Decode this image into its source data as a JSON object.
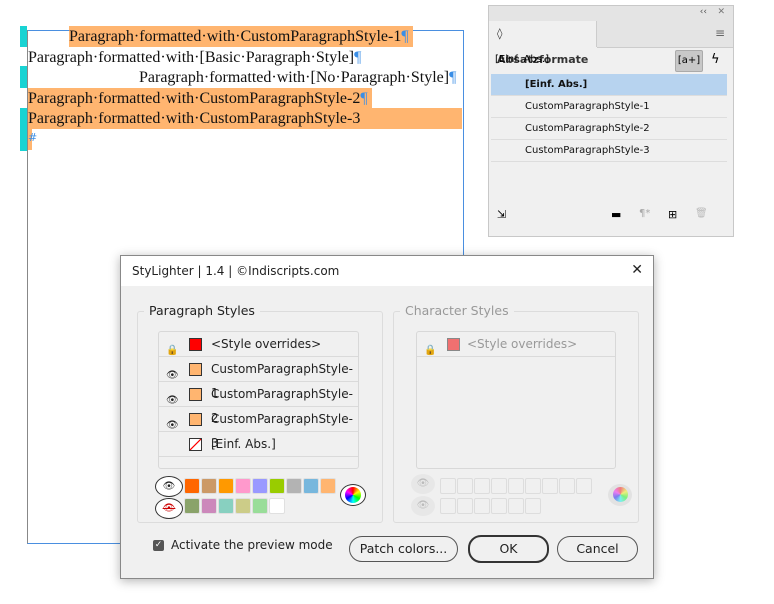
{
  "document": {
    "lines": [
      "Paragraph·formatted·with·CustomParagraphStyle-1",
      "Paragraph·formatted·with·[Basic·Paragraph·Style]",
      "Paragraph·formatted·with·[No·Paragraph·Style]",
      "Paragraph·formatted·with·CustomParagraphStyle-2",
      "Paragraph·formatted·with·CustomParagraphStyle-3"
    ],
    "pilcrow": "¶",
    "end_mark": "#",
    "highlight_color": "#ffb570"
  },
  "panel": {
    "collapse": "‹‹",
    "close": "✕",
    "title": "Absatzformate",
    "current_style": "[Einf. Abs.]",
    "new_style_btn": "[a+]",
    "styles": [
      "[Einf. Abs.]",
      "CustomParagraphStyle-1",
      "CustomParagraphStyle-2",
      "CustomParagraphStyle-3"
    ],
    "selected_index": 0
  },
  "dialog": {
    "title": "StyLighter | 1.4 | ©Indiscripts.com",
    "close": "✕",
    "paragraph_group": "Paragraph Styles",
    "character_group": "Character Styles",
    "paragraph_styles": [
      {
        "label": "<Style overrides>",
        "icon": "lock-icon",
        "color": "#ff0000"
      },
      {
        "label": "CustomParagraphStyle-1",
        "icon": "eye-icon",
        "color": "#ffb570"
      },
      {
        "label": "CustomParagraphStyle-2",
        "icon": "eye-icon",
        "color": "#ffb570"
      },
      {
        "label": "CustomParagraphStyle-3",
        "icon": "eye-icon",
        "color": "#ffb570"
      },
      {
        "label": "[Einf. Abs.]",
        "icon": "none",
        "color": "none"
      }
    ],
    "character_styles": [
      {
        "label": "<Style overrides>",
        "icon": "lock-icon",
        "color": "#f07070"
      }
    ],
    "palette_row1": [
      "#ff6600",
      "#cc9966",
      "#ff9900",
      "#ff99cc",
      "#9999ff",
      "#99cc00",
      "#b3b3b3",
      "#77b7dd",
      "#ffb570"
    ],
    "palette_row2": [
      "#8aa36a",
      "#cc88bb",
      "#88d0c0",
      "#cccc88",
      "#99dd99",
      "#ffffff"
    ],
    "preview_label": "Activate the preview mode",
    "preview_checked": true,
    "patch_label": "Patch colors...",
    "ok_label": "OK",
    "cancel_label": "Cancel"
  }
}
